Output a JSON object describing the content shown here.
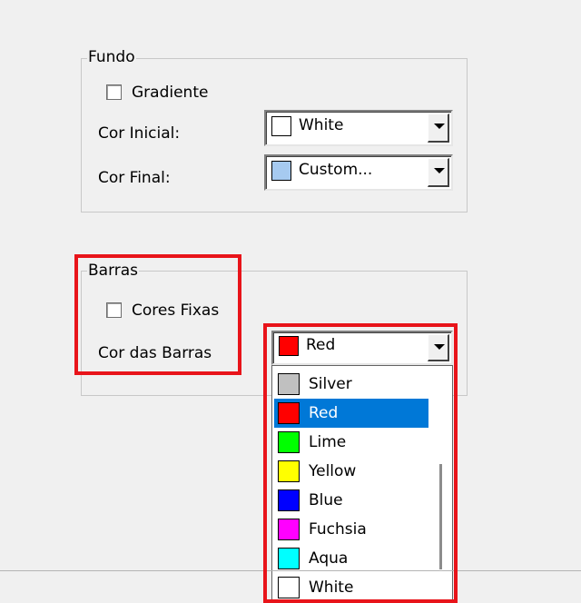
{
  "fundo": {
    "title": "Fundo",
    "gradient_label": "Gradiente",
    "gradient_checked": false,
    "cor_inicial_label": "Cor Inicial:",
    "cor_inicial_value": "White",
    "cor_inicial_color": "#ffffff",
    "cor_final_label": "Cor Final:",
    "cor_final_value": "Custom...",
    "cor_final_color": "#a6caf0"
  },
  "barras": {
    "title": "Barras",
    "cores_fixas_label": "Cores Fixas",
    "cores_fixas_checked": false,
    "cor_barras_label": "Cor das Barras",
    "cor_barras_value": "Red",
    "cor_barras_color": "#ff0000"
  },
  "dropdown": {
    "items": [
      {
        "label": "Silver",
        "color": "#c0c0c0"
      },
      {
        "label": "Red",
        "color": "#ff0000",
        "selected": true
      },
      {
        "label": "Lime",
        "color": "#00ff00"
      },
      {
        "label": "Yellow",
        "color": "#ffff00"
      },
      {
        "label": "Blue",
        "color": "#0000ff"
      },
      {
        "label": "Fuchsia",
        "color": "#ff00ff"
      },
      {
        "label": "Aqua",
        "color": "#00ffff"
      },
      {
        "label": "White",
        "color": "#ffffff"
      }
    ]
  },
  "highlight_color": "#e8141a",
  "selection_color": "#0078d7"
}
